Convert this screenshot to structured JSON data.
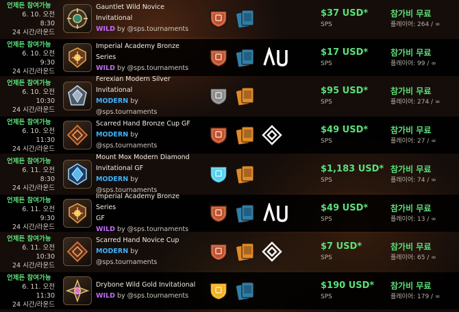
{
  "colors": {
    "green": "#5be07a",
    "wild": "#c46cf5",
    "modern": "#43b0f5",
    "bronze": "#c0502b",
    "silver": "#8a8a8a",
    "diamond": "#4fd3f0",
    "gold": "#f2b11c"
  },
  "tournaments": [
    {
      "open": "언제든 참여가능",
      "date": "6. 10. 오전 8:30",
      "format_text": "24 시간/라운드",
      "name": "Gauntlet Wild Novice Invitational",
      "name2": "",
      "mode": "WILD",
      "by": "by @sps.tournaments",
      "league": "novice",
      "league_color": "#c0502b",
      "emblem": "gauntlet-wild-emblem",
      "ruleset": [],
      "prize": "$37 USD*",
      "currency": "SPS",
      "fee": "참가비 무료",
      "players": "플레이어: 264 / ∞"
    },
    {
      "open": "언제든 참여가능",
      "date": "6. 10. 오전 9:30",
      "format_text": "24 시간/라운드",
      "name": "Imperial Academy Bronze Series",
      "name2": "",
      "mode": "WILD",
      "by": "by @sps.tournaments",
      "league": "bronze",
      "league_color": "#c0502b",
      "emblem": "imperial-academy-emblem",
      "ruleset": [
        "au"
      ],
      "prize": "$17 USD*",
      "currency": "SPS",
      "fee": "참가비 무료",
      "players": "플레이어: 99 / ∞"
    },
    {
      "open": "언제든 참여가능",
      "date": "6. 10. 오전 10:30",
      "format_text": "24 시간/라운드",
      "name": "Ferexian Modern Silver Invitational",
      "name2": "",
      "mode": "MODERN",
      "by": "by @sps.tournaments",
      "league": "silver",
      "league_color": "#8a8a8a",
      "emblem": "ferexian-emblem",
      "ruleset": [],
      "prize": "$95 USD*",
      "currency": "SPS",
      "fee": "참가비 무료",
      "players": "플레이어: 274 / ∞"
    },
    {
      "open": "언제든 참여가능",
      "date": "6. 10. 오전 11:30",
      "format_text": "24 시간/라운드",
      "name": "Scarred Hand Bronze Cup GF",
      "name2": "",
      "mode": "MODERN",
      "by": "by @sps.tournaments",
      "league": "bronze",
      "league_color": "#c0502b",
      "emblem": "scarred-hand-emblem",
      "ruleset": [
        "diamond-mark"
      ],
      "prize": "$49 USD*",
      "currency": "SPS",
      "fee": "참가비 무료",
      "players": "플레이어: 27 / ∞"
    },
    {
      "open": "언제든 참여가능",
      "date": "6. 11. 오전 8:30",
      "format_text": "24 시간/라운드",
      "name": "Mount Mox Modern Diamond",
      "name2": "Invitational GF",
      "mode": "MODERN",
      "by": "by @sps.tournaments",
      "league": "diamond",
      "league_color": "#4fd3f0",
      "emblem": "mount-mox-emblem",
      "ruleset": [],
      "prize": "$1,183 USD*",
      "currency": "SPS",
      "fee": "참가비 무료",
      "players": "플레이어: 74 / ∞"
    },
    {
      "open": "언제든 참여가능",
      "date": "6. 11. 오전 9:30",
      "format_text": "24 시간/라운드",
      "name": "Imperial Academy Bronze Series",
      "name2": "GF",
      "mode": "WILD",
      "by": "by @sps.tournaments",
      "league": "bronze",
      "league_color": "#c0502b",
      "emblem": "imperial-academy-emblem",
      "ruleset": [
        "au"
      ],
      "prize": "$49 USD*",
      "currency": "SPS",
      "fee": "참가비 무료",
      "players": "플레이어: 13 / ∞"
    },
    {
      "open": "언제든 참여가능",
      "date": "6. 11. 오전 10:30",
      "format_text": "24 시간/라운드",
      "name": "Scarred Hand Novice Cup",
      "name2": "",
      "mode": "MODERN",
      "by": "by @sps.tournaments",
      "league": "novice",
      "league_color": "#c0502b",
      "emblem": "scarred-hand-emblem",
      "ruleset": [
        "diamond-mark"
      ],
      "prize": "$7 USD*",
      "currency": "SPS",
      "fee": "참가비 무료",
      "players": "플레이어: 65 / ∞"
    },
    {
      "open": "언제든 참여가능",
      "date": "6. 11. 오전 11:30",
      "format_text": "24 시간/라운드",
      "name": "Drybone Wild Gold Invitational",
      "name2": "",
      "mode": "WILD",
      "by": "by @sps.tournaments",
      "league": "gold",
      "league_color": "#f2b11c",
      "emblem": "drybone-emblem",
      "ruleset": [],
      "prize": "$190 USD*",
      "currency": "SPS",
      "fee": "참가비 무료",
      "players": "플레이어: 179 / ∞"
    }
  ]
}
